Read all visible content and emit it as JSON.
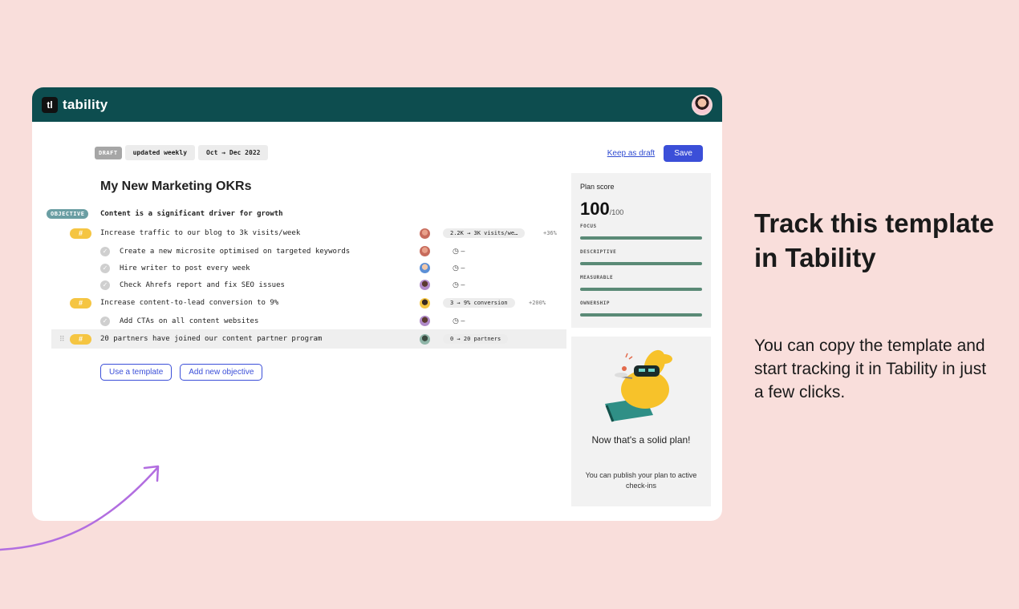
{
  "app": {
    "brand_mark": "tl",
    "brand_name": "tability"
  },
  "toolbar": {
    "draft_label": "DRAFT",
    "frequency": "updated weekly",
    "period": "Oct → Dec 2022",
    "keep_draft": "Keep as draft",
    "save_label": "Save"
  },
  "plan": {
    "title": "My New Marketing OKRs",
    "objective": {
      "badge": "OBJECTIVE",
      "text": "Content is a significant driver for growth"
    },
    "key_results": [
      {
        "hash": "#",
        "text": "Increase traffic to our blog to 3k visits/week",
        "progress": "2.2K → 3K visits/we…",
        "delta": "+36%",
        "tasks": [
          {
            "text": "Create a new microsite optimised on targeted keywords",
            "due": "–"
          },
          {
            "text": "Hire writer to post every week",
            "due": "–"
          },
          {
            "text": "Check Ahrefs report and fix SEO issues",
            "due": "–"
          }
        ]
      },
      {
        "hash": "#",
        "text": "Increase content-to-lead conversion to 9%",
        "progress": "3 → 9% conversion",
        "delta": "+200%",
        "tasks": [
          {
            "text": "Add CTAs on all content websites",
            "due": "–"
          }
        ]
      },
      {
        "hash": "#",
        "text": "20 partners have joined our content partner program",
        "progress": "0 → 20 partners",
        "delta": ""
      }
    ],
    "use_template": "Use a template",
    "add_objective": "Add new objective"
  },
  "score": {
    "label": "Plan score",
    "value": "100",
    "max": "/100",
    "metrics": [
      "FOCUS",
      "DESCRIPTIVE",
      "MEASURABLE",
      "OWNERSHIP"
    ]
  },
  "solid": {
    "title": "Now that's a solid plan!",
    "subtitle": "You can publish your plan to active check-ins"
  },
  "promo": {
    "title": "Track this template in Tability",
    "body": "You can copy the template and start tracking it in Tability in just a few clicks."
  },
  "colors": {
    "background": "#f9dedb",
    "topbar": "#0d4d4f",
    "accent": "#3b4fd8",
    "hash_badge": "#f5c542",
    "score_bar": "#5a8a76",
    "arrow": "#b26ee0"
  }
}
